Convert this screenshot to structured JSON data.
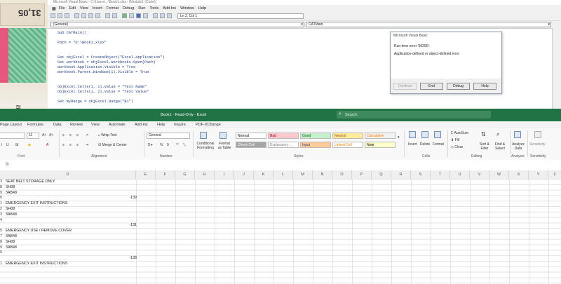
{
  "vbe": {
    "title": "Microsoft Visual Basic - C:\\Users\\...\\Book1.xlsx - [Module1 (Code)]",
    "menu": [
      "File",
      "Edit",
      "View",
      "Insert",
      "Format",
      "Debug",
      "Run",
      "Tools",
      "Add-Ins",
      "Window",
      "Help"
    ],
    "position": "Ln 2, Col 1",
    "object_combo": "(General)",
    "proc_combo": "CATMain",
    "code": [
      "Sub CATMain()",
      "",
      "Path = \"D:\\Book1.xlsx\"",
      "",
      "",
      "Set objExcel = CreateObject(\"Excel.Application\")",
      "Set workbook = objExcel.Workbooks.Open(Path)",
      "workbook.Application.Visible = True",
      "workbook.Parent.Windows(1).Visible = True",
      "",
      "",
      "objExcel.Cells(1, 1).Value = \"Text Name\"",
      "objExcel.Cells(1, 2).Value = \"Text Value\"",
      "",
      "Set myRange = objExcel.Range(\"B1\")"
    ]
  },
  "dialog": {
    "title": "Microsoft Visual Basic",
    "message1": "Run-time error '50290':",
    "message2": "Application-defined or object-defined error",
    "buttons": {
      "continue": "Continue",
      "end": "End",
      "debug": "Debug",
      "help": "Help"
    }
  },
  "photo": {
    "number": "31,05"
  },
  "excel": {
    "title": "Book1 - Read-Only - Excel",
    "search_placeholder": "Search",
    "tabs": [
      "Page Layout",
      "Formulas",
      "Data",
      "Review",
      "View",
      "Automate",
      "Add-ins",
      "Help",
      "Inquire",
      "PDF-XChange"
    ],
    "ribbon": {
      "font_size": "11",
      "wrap_text": "Wrap Text",
      "merge_center": "Merge & Center",
      "number_format": "General",
      "cond_format": "Conditional Formatting",
      "format_table": "Format as Table",
      "styles": [
        {
          "label": "Normal",
          "bg": "#ffffff",
          "fg": "#000000"
        },
        {
          "label": "Bad",
          "bg": "#ffc7ce",
          "fg": "#9c0006"
        },
        {
          "label": "Good",
          "bg": "#c6efce",
          "fg": "#006100"
        },
        {
          "label": "Neutral",
          "bg": "#ffeb9c",
          "fg": "#9c5700"
        },
        {
          "label": "Calculation",
          "bg": "#f2f2f2",
          "fg": "#fa7d00"
        },
        {
          "label": "Check Cell",
          "bg": "#a5a5a5",
          "fg": "#ffffff"
        },
        {
          "label": "Explanatory ...",
          "bg": "#ffffff",
          "fg": "#7f7f7f"
        },
        {
          "label": "Input",
          "bg": "#ffcc99",
          "fg": "#3f3f76"
        },
        {
          "label": "Linked Cell",
          "bg": "#ffffff",
          "fg": "#fa7d00"
        },
        {
          "label": "Note",
          "bg": "#ffffcc",
          "fg": "#000000"
        }
      ],
      "insert": "Insert",
      "delete": "Delete",
      "format": "Format",
      "autosum": "AutoSum",
      "fill": "Fill",
      "clear": "Clear",
      "sort_filter": "Sort & Filter",
      "find_select": "Find & Select",
      "analyze": "Analyze Data",
      "sensitivity": "Sensitivity",
      "groups": [
        "Font",
        "Alignment",
        "Number",
        "Styles",
        "Cells",
        "Editing",
        "Analysis",
        "Sensitivity"
      ]
    },
    "fx": "fx",
    "columns": [
      "D",
      "E",
      "F",
      "G",
      "H",
      "I",
      "J",
      "K",
      "L",
      "M",
      "N",
      "O",
      "P",
      "Q",
      "R",
      "S",
      "T",
      "U",
      "V",
      "W",
      "X",
      "Y",
      "Z"
    ],
    "rows": [
      {
        "n": "3",
        "d": "SEAT BELT STORAGE ONLY",
        "e": ""
      },
      {
        "n": "8",
        "d": "SH08",
        "e": ""
      },
      {
        "n": "9",
        "d": "3AB48",
        "e": ""
      },
      {
        "n": "0",
        "d": "",
        "e": "-139"
      },
      {
        "n": "1",
        "d": "EMERGENCY EXIT INSTRUCTIONS",
        "e": ""
      },
      {
        "n": "2",
        "d": "SH08",
        "e": ""
      },
      {
        "n": "3",
        "d": "3AB48",
        "e": ""
      },
      {
        "n": "4",
        "d": "",
        "e": "-131"
      },
      {
        "n": "5",
        "d": "EMERGENCY USE / REMOVE COVER",
        "e": ""
      },
      {
        "n": "7",
        "d": "3AB48",
        "e": ""
      },
      {
        "n": "8",
        "d": "SH08",
        "e": ""
      },
      {
        "n": "9",
        "d": "3AB48",
        "e": ""
      },
      {
        "n": "0",
        "d": "",
        "e": "-138"
      },
      {
        "n": "1",
        "d": "EMERGENCY EXIT INSTRUCTIONS",
        "e": ""
      }
    ]
  }
}
